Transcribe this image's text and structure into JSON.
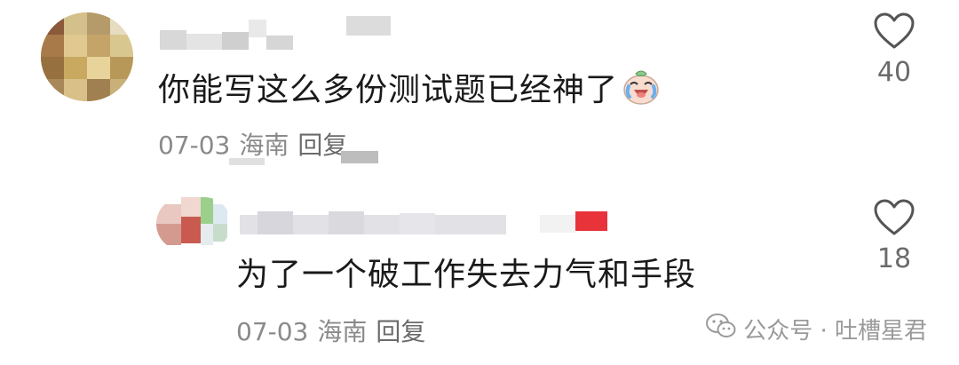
{
  "comments": [
    {
      "text": "你能写这么多份测试题已经神了",
      "emoji": "crying-laughing-sticker",
      "date": "07-03",
      "location": "海南",
      "reply_label": "回复",
      "likes": "40"
    },
    {
      "text": "为了一个破工作失去力气和手段",
      "date": "07-03",
      "location": "海南",
      "reply_label": "回复",
      "likes": "18"
    }
  ],
  "watermark": {
    "icon": "wechat-icon",
    "text": "公众号 · 吐槽星君"
  },
  "colors": {
    "text": "#1a1a1a",
    "meta": "#8a8a8a",
    "heart": "#555555",
    "badge_red": "#e8333b"
  }
}
